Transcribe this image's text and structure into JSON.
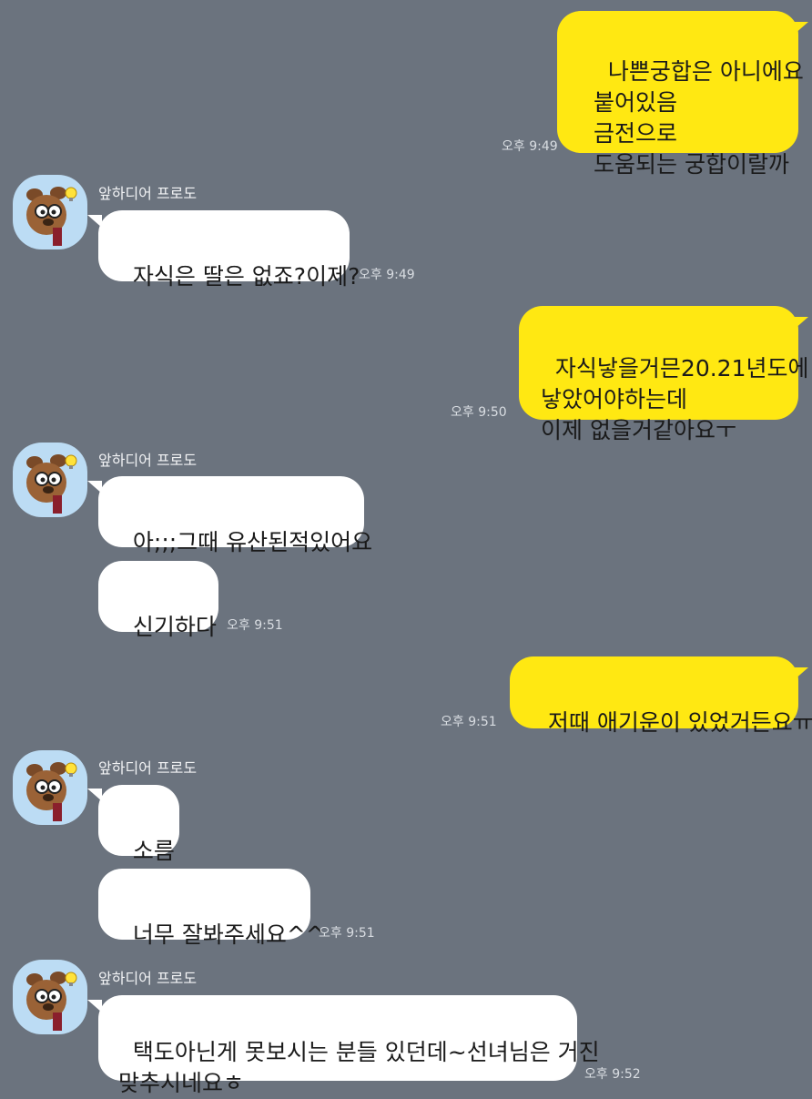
{
  "contact": {
    "name": "앞하디어 프로도",
    "avatar_icon": "frodo-character-icon"
  },
  "colors": {
    "background": "#6b737e",
    "my_bubble": "#ffe812",
    "their_bubble": "#ffffff"
  },
  "messages": [
    {
      "from": "me",
      "text": "나쁜궁합은 아니에요\n붙어있음\n금전으로\n도움되는 궁합이랄까",
      "time": "오후 9:49"
    },
    {
      "from": "them",
      "text": "자식은 딸은 없죠?이제?",
      "time": "오후 9:49"
    },
    {
      "from": "me",
      "text": "자식낳을거믄20.21년도에\n낳았어야하는데\n이제 없을거같아요ㅜ",
      "time": "오후 9:50"
    },
    {
      "from": "them",
      "text": "아;;;그때 유산된적있어요",
      "time": ""
    },
    {
      "from": "them",
      "text": "신기하다",
      "time": "오후 9:51"
    },
    {
      "from": "me",
      "text": "저때 애기운이 있었거든요ㅠ",
      "time": "오후 9:51"
    },
    {
      "from": "them",
      "text": "소름",
      "time": ""
    },
    {
      "from": "them",
      "text": "너무 잘봐주세요^^",
      "time": "오후 9:51"
    },
    {
      "from": "them",
      "text": "택도아닌게 못보시는 분들 있던데~선녀님은 거진\n맞추시네요ㅎ",
      "time": "오후 9:52"
    }
  ]
}
